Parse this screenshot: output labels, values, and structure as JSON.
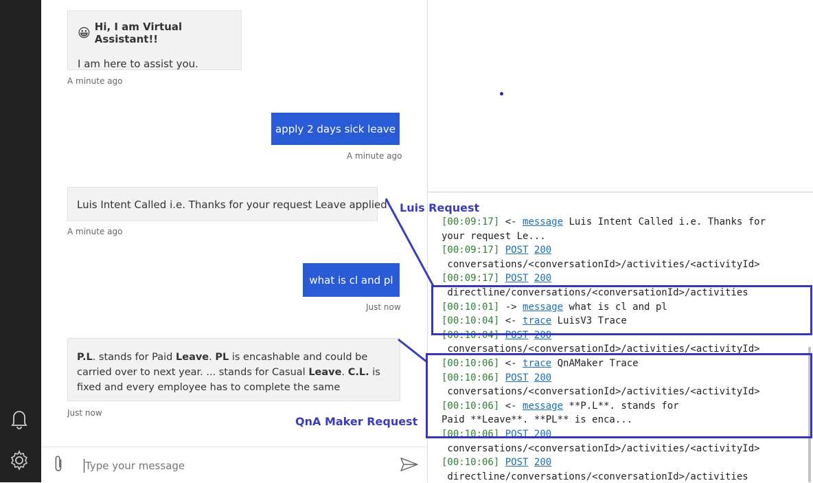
{
  "chat": {
    "welcome_emoji": "😀",
    "welcome_title": "Hi, I am Virtual Assistant!!",
    "welcome_body": "I am here to assist you.",
    "welcome_time": "A minute ago",
    "user_msg1": "apply 2 days sick leave",
    "user_msg1_time": "A minute ago",
    "bot_msg2": "Luis Intent Called i.e. Thanks for your request Leave applied",
    "bot_msg2_time": "A minute ago",
    "user_msg2": "what is cl and pl",
    "user_msg2_time": "Just now",
    "bot_msg3": {
      "p1_bold": "P.L",
      "p1": ". stands for Paid ",
      "p2_bold": "Leave",
      "p2": ". ",
      "p3_bold": "PL",
      "p3": " is encashable and could be carried over to next year. ... stands for Casual ",
      "p4_bold": "Leave",
      "p4": ". ",
      "p5_bold": "C.L.",
      "p5": " is fixed and every employee has to complete the same"
    },
    "bot_msg3_time": "Just now",
    "input_placeholder": "Type your message"
  },
  "log": {
    "lines": [
      {
        "time": "[00:09:17]",
        "dir": " <- ",
        "link": "message",
        "text": " Luis Intent Called i.e. Thanks for"
      },
      {
        "time": "",
        "dir": "",
        "link": "",
        "text": "your request Le..."
      },
      {
        "time": "[00:09:17]",
        "dir": " ",
        "link": "POST",
        "link2": "200",
        "text": ""
      },
      {
        "time": "",
        "dir": "",
        "link": "",
        "text": " conversations/<conversationId>/activities/<activityId>"
      },
      {
        "time": "[00:09:17]",
        "dir": " ",
        "link": "POST",
        "link2": "200",
        "text": ""
      },
      {
        "time": "",
        "dir": "",
        "link": "",
        "text": " directline/conversations/<conversationId>/activities"
      },
      {
        "time": "[00:10:01]",
        "dir": " -> ",
        "link": "message",
        "text": " what is cl and pl"
      },
      {
        "time": "[00:10:04]",
        "dir": " <- ",
        "link": "trace",
        "text": " LuisV3 Trace"
      },
      {
        "time": "[00:10:04]",
        "dir": " ",
        "link": "POST",
        "link2": "200",
        "text": ""
      },
      {
        "time": "",
        "dir": "",
        "link": "",
        "text": " conversations/<conversationId>/activities/<activityId>"
      },
      {
        "time": "[00:10:06]",
        "dir": " <- ",
        "link": "trace",
        "text": " QnAMaker Trace"
      },
      {
        "time": "[00:10:06]",
        "dir": " ",
        "link": "POST",
        "link2": "200",
        "text": ""
      },
      {
        "time": "",
        "dir": "",
        "link": "",
        "text": " conversations/<conversationId>/activities/<activityId>"
      },
      {
        "time": "[00:10:06]",
        "dir": " <- ",
        "link": "message",
        "text": " **P.L**. stands for"
      },
      {
        "time": "",
        "dir": "",
        "link": "",
        "text": "Paid **Leave**. **PL** is enca..."
      },
      {
        "time": "[00:10:06]",
        "dir": " ",
        "link": "POST",
        "link2": "200",
        "text": ""
      },
      {
        "time": "",
        "dir": "",
        "link": "",
        "text": " conversations/<conversationId>/activities/<activityId>"
      },
      {
        "time": "[00:10:06]",
        "dir": " ",
        "link": "POST",
        "link2": "200",
        "text": ""
      },
      {
        "time": "",
        "dir": "",
        "link": "",
        "text": " directline/conversations/<conversationId>/activities"
      }
    ]
  },
  "annotations": {
    "luis": "Luis Request",
    "qna": "QnA Maker Request",
    "color": "#3a3dbd"
  }
}
